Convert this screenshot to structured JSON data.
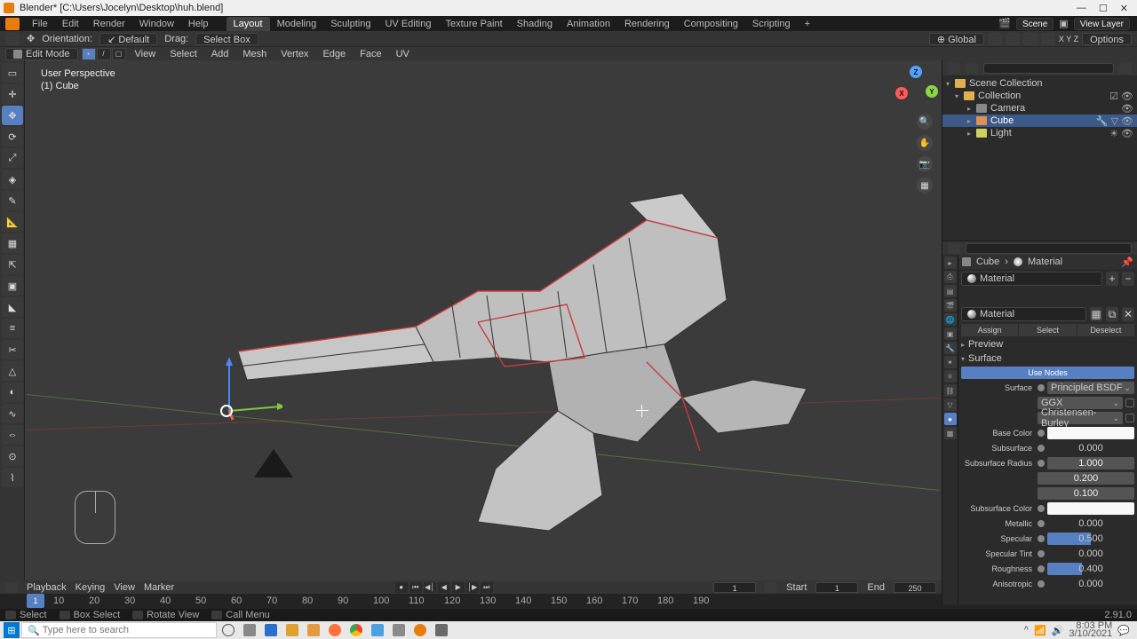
{
  "title": "Blender* [C:\\Users\\Jocelyn\\Desktop\\huh.blend]",
  "app_menu": {
    "items": [
      "File",
      "Edit",
      "Render",
      "Window",
      "Help"
    ]
  },
  "workspace_tabs": [
    "Layout",
    "Modeling",
    "Sculpting",
    "UV Editing",
    "Texture Paint",
    "Shading",
    "Animation",
    "Rendering",
    "Compositing",
    "Scripting"
  ],
  "workspace_active": "Layout",
  "scene_field": "Scene",
  "viewlayer_field": "View Layer",
  "hdr": {
    "orientation_label": "Orientation:",
    "orientation_value": "Default",
    "drag_label": "Drag:",
    "drag_value": "Select Box",
    "transform_orientation": "Global",
    "options_label": "Options"
  },
  "hdr2": {
    "mode": "Edit Mode",
    "menus": [
      "View",
      "Select",
      "Add",
      "Mesh",
      "Vertex",
      "Edge",
      "Face",
      "UV"
    ]
  },
  "viewport": {
    "perspective": "User Perspective",
    "object": "(1) Cube"
  },
  "outliner": {
    "root": "Scene Collection",
    "collection": "Collection",
    "camera": "Camera",
    "cube": "Cube",
    "light": "Light"
  },
  "properties": {
    "crumb_object": "Cube",
    "crumb_material": "Material",
    "material_slot": "Material",
    "material_name": "Material",
    "assign": "Assign",
    "select": "Select",
    "deselect": "Deselect",
    "preview": "Preview",
    "surface_section": "Surface",
    "use_nodes": "Use Nodes",
    "surface_label": "Surface",
    "surface_value": "Principled BSDF",
    "ggx": "GGX",
    "burley": "Christensen-Burley",
    "base_color_label": "Base Color",
    "subsurface_label": "Subsurface",
    "subsurface_value": "0.000",
    "subsurface_radius_label": "Subsurface Radius",
    "subsurface_radius_1": "1.000",
    "subsurface_radius_2": "0.200",
    "subsurface_radius_3": "0.100",
    "subsurface_color_label": "Subsurface Color",
    "metallic_label": "Metallic",
    "metallic_value": "0.000",
    "specular_label": "Specular",
    "specular_value": "0.500",
    "specular_tint_label": "Specular Tint",
    "specular_tint_value": "0.000",
    "roughness_label": "Roughness",
    "roughness_value": "0.400",
    "anisotropic_label": "Anisotropic",
    "anisotropic_value": "0.000"
  },
  "timeline": {
    "playback": "Playback",
    "keying": "Keying",
    "view": "View",
    "marker": "Marker",
    "current_frame": "1",
    "start_label": "Start",
    "start_value": "1",
    "end_label": "End",
    "end_value": "250",
    "ticks": [
      "10",
      "20",
      "30",
      "40",
      "50",
      "60",
      "70",
      "80",
      "90",
      "100",
      "110",
      "120",
      "130",
      "140",
      "150",
      "160",
      "170",
      "180",
      "190"
    ]
  },
  "status": {
    "select": "Select",
    "box_select": "Box Select",
    "rotate_view": "Rotate View",
    "call_menu": "Call Menu",
    "version": "2.91.0"
  },
  "taskbar": {
    "search_placeholder": "Type here to search",
    "time": "8:03 PM",
    "date": "3/10/2021"
  }
}
